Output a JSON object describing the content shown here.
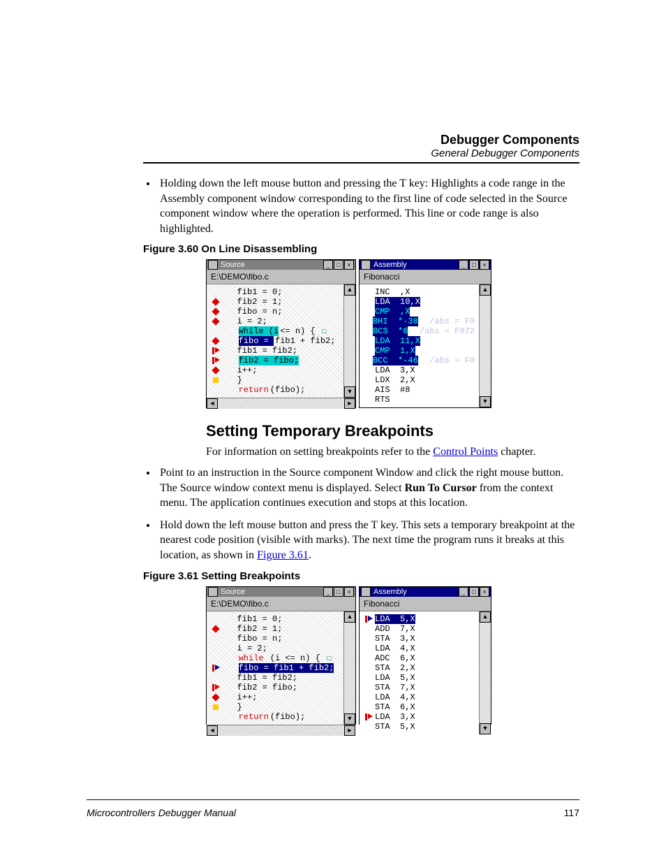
{
  "header": {
    "title": "Debugger Components",
    "subtitle": "General Debugger Components"
  },
  "top_bullet": "Holding down the left mouse button and pressing the T key: Highlights a code range in the Assembly component window corresponding to the first line of code selected in the Source component window where the operation is performed. This line or code range is also highlighted.",
  "figA": {
    "caption": "Figure 3.60  On Line Disassembling"
  },
  "figB": {
    "caption": "Figure 3.61  Setting Breakpoints"
  },
  "section_heading": "Setting Temporary Breakpoints",
  "intro_before": "For information on setting breakpoints refer to the ",
  "intro_link": "Control Points",
  "intro_after": " chapter.",
  "bullets2": [
    {
      "pre": "Point to an instruction in the Source component Window and click the right mouse button. The Source window context menu is displayed. Select ",
      "bold": "Run To Cursor",
      "post": " from the context menu. The application continues execution and stops at this location."
    },
    {
      "pre": "Hold down the left mouse button and press the T key. This sets a temporary breakpoint at the nearest code position (visible with marks). The next time the program runs it breaks at this location, as shown in ",
      "link": "Figure 3.61",
      "post": "."
    }
  ],
  "win_titles": {
    "source": "Source",
    "assembly": "Assembly"
  },
  "win_path": "E:\\DEMO\\fibo.c",
  "asm_label": "Fibonacci",
  "figA_src": {
    "lines": [
      {
        "mark": "",
        "text": "   fib1 = 0;"
      },
      {
        "mark": "red",
        "text": "   fib2 = 1;"
      },
      {
        "mark": "red",
        "text": "   fibo = n;"
      },
      {
        "mark": "red",
        "text": "   i = 2;"
      },
      {
        "mark": "",
        "pre": "   ",
        "hl": "while (i",
        "mid": "<= n) {",
        "tail_icon": true
      },
      {
        "mark": "red",
        "pre": "   ",
        "hl2": "fibo = ",
        "rest": "fib1 + fib2;"
      },
      {
        "mark": "arrow-red",
        "text": "   fib1 = fib2;"
      },
      {
        "mark": "arrow-red",
        "pre": "   ",
        "hl3": "fib2 = fibo;"
      },
      {
        "mark": "red",
        "text": "   i++;"
      },
      {
        "mark": "ylw",
        "text": "   }"
      },
      {
        "mark": "",
        "pre": "   ",
        "red": "return",
        "rest": "(fibo);"
      }
    ]
  },
  "figA_asm": {
    "lines": [
      {
        "op": "INC",
        "arg": ",X"
      },
      {
        "hl": true,
        "op": "LDA",
        "arg": "10,X"
      },
      {
        "cy": true,
        "op": "CMP",
        "arg": ",X"
      },
      {
        "cy": true,
        "op": "BHI",
        "arg": "*-38",
        "com": "/abs = F0"
      },
      {
        "cy": true,
        "op": "BCS",
        "arg": "*6",
        "com": "/abs = F072"
      },
      {
        "cy": true,
        "op": "LDA",
        "arg": "11,X"
      },
      {
        "cy": true,
        "op": "CMP",
        "arg": "1,X"
      },
      {
        "cy": true,
        "op": "BCC",
        "arg": "*-46",
        "com": "/abs = F0"
      },
      {
        "op": "LDA",
        "arg": "3,X"
      },
      {
        "op": "LDX",
        "arg": "2,X"
      },
      {
        "op": "AIS",
        "arg": "#8"
      },
      {
        "op": "RTS",
        "arg": ""
      }
    ]
  },
  "figB_src": {
    "lines": [
      {
        "mark": "",
        "text": "   fib1 = 0;"
      },
      {
        "mark": "red",
        "text": "   fib2 = 1;"
      },
      {
        "mark": "",
        "text": "   fibo = n;"
      },
      {
        "mark": "",
        "text": "   i = 2;"
      },
      {
        "mark": "",
        "pre": "   ",
        "red": "while",
        "rest": " (i <= n) {",
        "tail_icon": true
      },
      {
        "mark": "arrow-blue",
        "pre": "   ",
        "hl2": "fibo = fib1 + fib2;"
      },
      {
        "mark": "",
        "text": "   fib1 = fib2;"
      },
      {
        "mark": "arrow-red",
        "text": "   fib2 = fibo;"
      },
      {
        "mark": "red",
        "text": "   i++;"
      },
      {
        "mark": "ylw",
        "text": "   }"
      },
      {
        "mark": "",
        "pre": "   ",
        "red": "return",
        "rest": "(fibo);"
      }
    ]
  },
  "figB_asm": {
    "lines": [
      {
        "mark": "arrow-blue",
        "hl": true,
        "op": "LDA",
        "arg": "5,X"
      },
      {
        "op": "ADD",
        "arg": "7,X"
      },
      {
        "op": "STA",
        "arg": "3,X"
      },
      {
        "op": "LDA",
        "arg": "4,X"
      },
      {
        "op": "ADC",
        "arg": "6,X"
      },
      {
        "op": "STA",
        "arg": "2,X"
      },
      {
        "op": "LDA",
        "arg": "5,X"
      },
      {
        "op": "STA",
        "arg": "7,X"
      },
      {
        "op": "LDA",
        "arg": "4,X"
      },
      {
        "op": "STA",
        "arg": "6,X"
      },
      {
        "mark": "arrow-red",
        "op": "LDA",
        "arg": "3,X"
      },
      {
        "op": "STA",
        "arg": "5,X"
      }
    ]
  },
  "footer": {
    "left": "Microcontrollers Debugger Manual",
    "page": "117"
  }
}
